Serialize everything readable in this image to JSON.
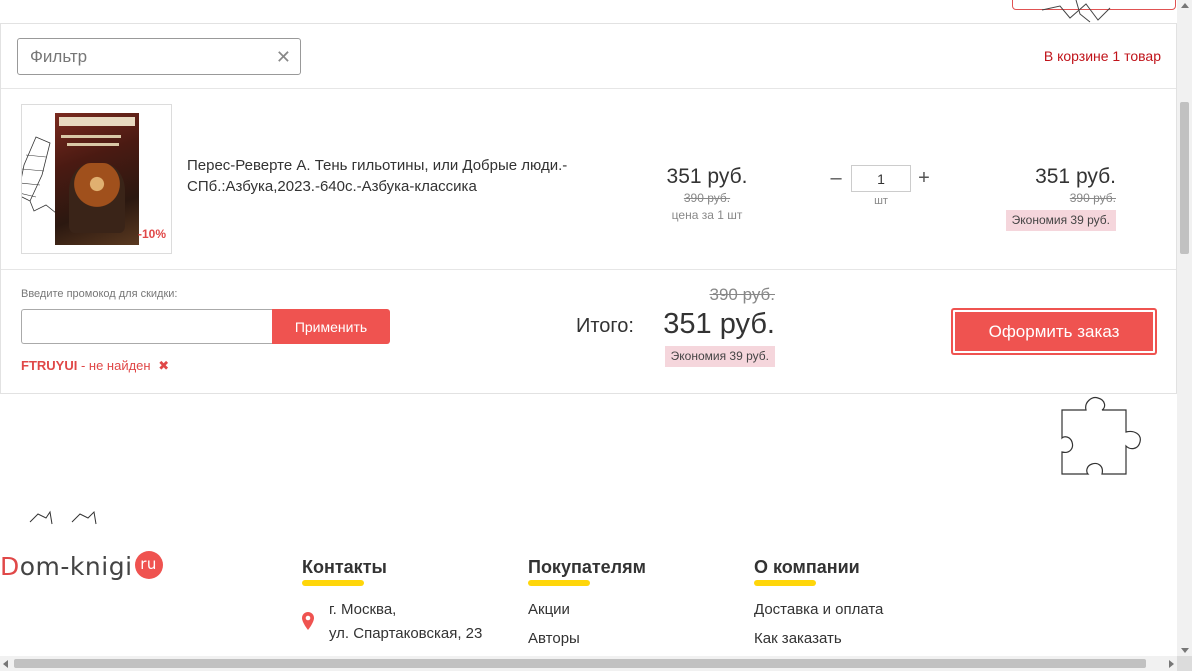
{
  "filter": {
    "placeholder": "Фильтр",
    "clear_glyph": "✕"
  },
  "cart": {
    "count_text": "В корзине 1 товар"
  },
  "item": {
    "title": "Перес-Реверте А. Тень гильотины, или Добрые люди.-СПб.:Азбука,2023.-640с.-Азбука-классика",
    "discount_badge": "-10%",
    "unit_price": "351 руб.",
    "unit_old_price": "390 руб.",
    "unit_note": "цена за 1 шт",
    "qty_minus": "–",
    "qty_plus": "+",
    "quantity": "1",
    "qty_unit": "шт",
    "total_price": "351 руб.",
    "total_old_price": "390 руб.",
    "economy": "Экономия 39 руб."
  },
  "promo": {
    "label": "Введите промокод для скидки:",
    "input_value": "",
    "apply_label": "Применить",
    "code": "FTRUYUI",
    "status": " - не найден",
    "remove_glyph": "✖"
  },
  "summary": {
    "label": "Итого:",
    "old_total": "390 руб.",
    "total": "351 руб.",
    "economy": "Экономия 39 руб.",
    "checkout_label": "Оформить заказ"
  },
  "footer": {
    "logo_first": "D",
    "logo_rest": "om-knigi",
    "logo_badge": "ru",
    "contacts": {
      "title": "Контакты",
      "address_line1": "г. Москва,",
      "address_line2": "ул. Спартаковская, 23"
    },
    "buyers": {
      "title": "Покупателям",
      "links": [
        "Акции",
        "Авторы"
      ]
    },
    "company": {
      "title": "О компании",
      "links": [
        "Доставка и оплата",
        "Как заказать"
      ]
    }
  },
  "colors": {
    "accent": "#ef5350",
    "alert_text": "#c0131a",
    "underline": "#ffd60a",
    "economy_bg": "#f5d6dc"
  }
}
